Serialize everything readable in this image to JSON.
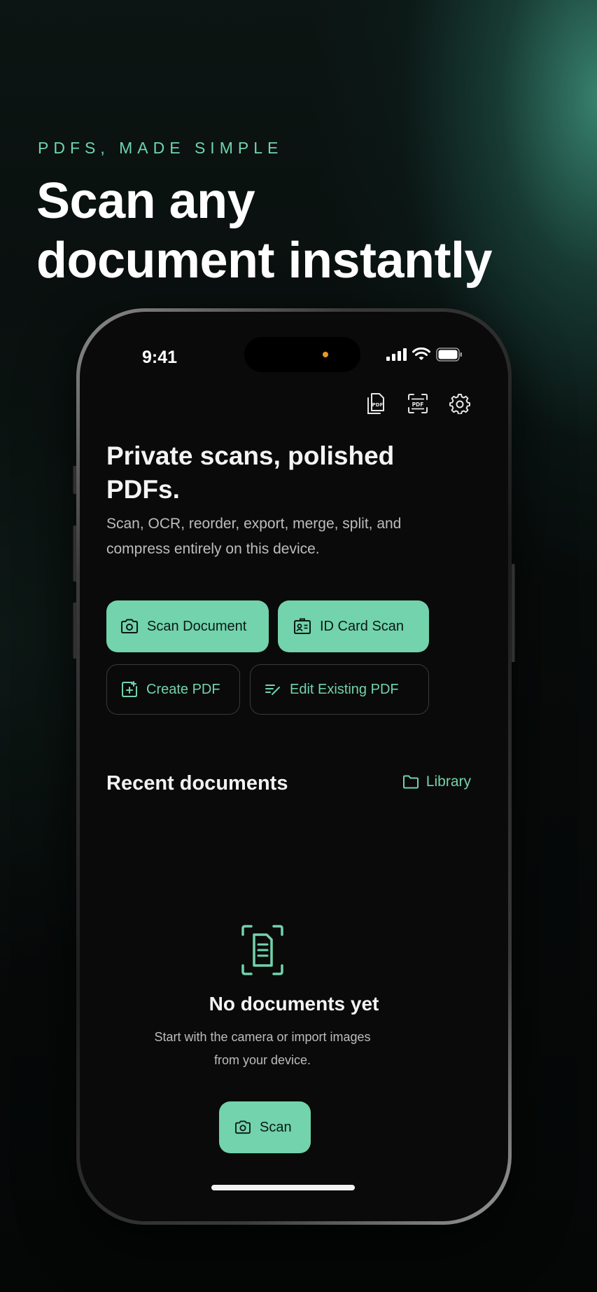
{
  "marketing": {
    "eyebrow": "PDFS, MADE SIMPLE",
    "headline_line1": "Scan any",
    "headline_line2": "document instantly"
  },
  "status_bar": {
    "time": "9:41",
    "icons": [
      "cellular-signal-icon",
      "wifi-icon",
      "battery-icon"
    ]
  },
  "toolbar": {
    "icons": [
      "pdf-document-icon",
      "pdf-scan-icon",
      "gear-icon"
    ]
  },
  "hero": {
    "title": "Private scans, polished PDFs.",
    "subtitle": "Scan, OCR, reorder, export, merge, split, and compress entirely on this device."
  },
  "actions": {
    "scan_document": "Scan Document",
    "id_card_scan": "ID Card Scan",
    "create_pdf": "Create PDF",
    "edit_existing_pdf": "Edit Existing PDF"
  },
  "recent": {
    "title": "Recent documents",
    "library_label": "Library"
  },
  "empty_state": {
    "title": "No documents yet",
    "subtitle": "Start with the camera or import images from your device.",
    "button_label": "Scan"
  },
  "colors": {
    "accent": "#72d3ac",
    "background": "#0a0a0a",
    "text": "#f4f4f4",
    "muted": "#bdbdbd"
  }
}
